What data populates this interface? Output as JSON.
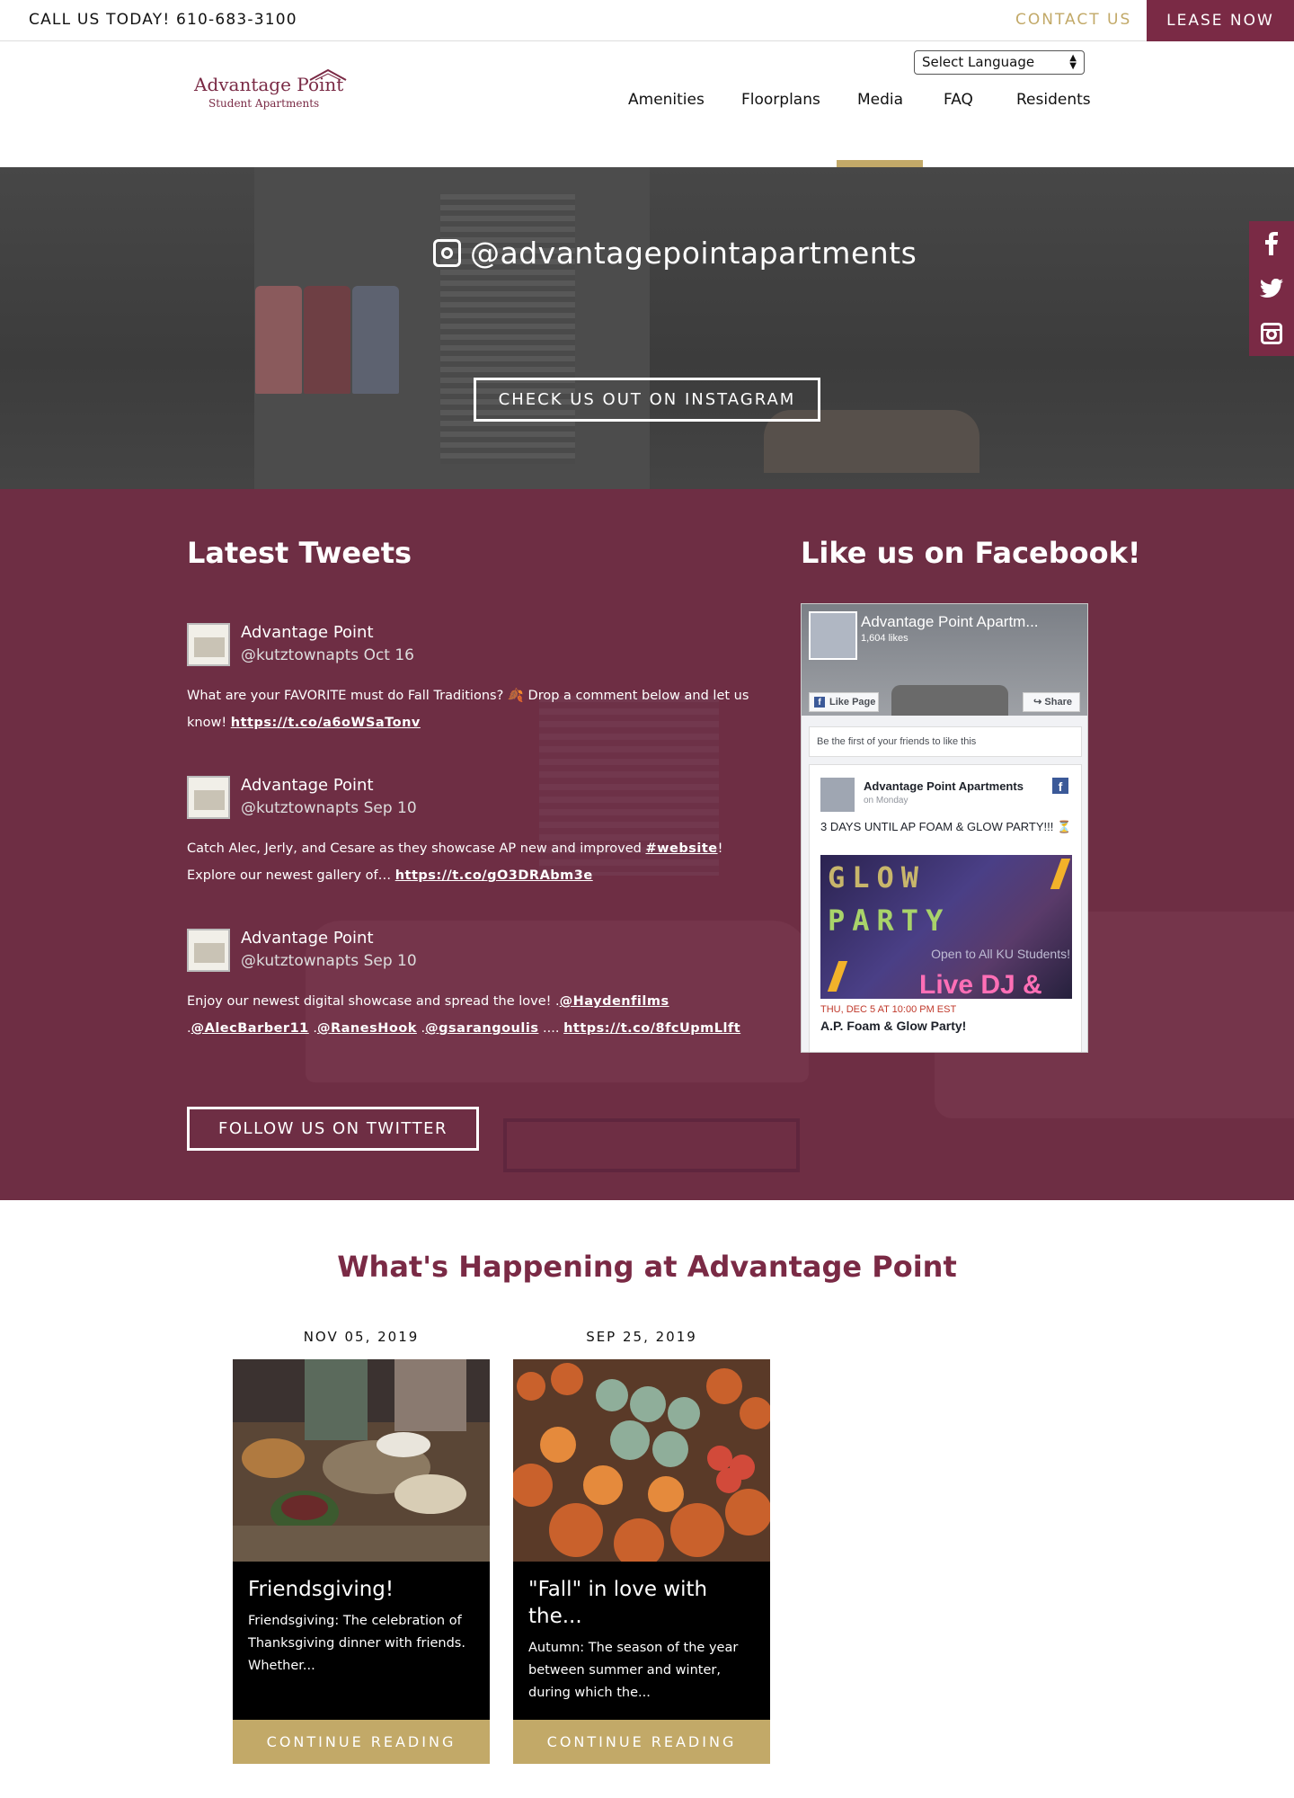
{
  "topbar": {
    "call": "CALL US TODAY! 610-683-3100",
    "contact": "CONTACT US",
    "lease": "LEASE NOW"
  },
  "header": {
    "language_select": "Select Language",
    "logo_main": "Advantage Point",
    "logo_sub": "Student Apartments",
    "nav": [
      {
        "label": "Amenities"
      },
      {
        "label": "Floorplans"
      },
      {
        "label": "Media"
      },
      {
        "label": "FAQ"
      },
      {
        "label": "Residents"
      }
    ],
    "active_nav": "Media"
  },
  "instagram": {
    "handle": "@advantagepointapartments",
    "button": "CHECK US OUT ON INSTAGRAM"
  },
  "social": {
    "facebook": "f",
    "twitter": "🐦",
    "instagram": "ig"
  },
  "tweets": {
    "heading": "Latest Tweets",
    "items": [
      {
        "name": "Advantage Point",
        "handle": "@kutztownapts Oct 16",
        "text": "What are your FAVORITE must do Fall Traditions? 🍂 Drop a comment below and let us know! ",
        "link": "https://t.co/a6oWSaTonv"
      },
      {
        "name": "Advantage Point",
        "handle": "@kutztownapts Sep 10",
        "text_before": "Catch Alec, Jerly, and Cesare as they showcase AP new and improved ",
        "hashtag": "#website",
        "text_after": "! Explore our newest gallery of… ",
        "link": "https://t.co/gO3DRAbm3e"
      },
      {
        "name": "Advantage Point",
        "handle": "@kutztownapts Sep 10",
        "text": "Enjoy our newest digital showcase and spread the love! .",
        "mention1": "@Haydenfilms",
        "sep1": " .",
        "mention2": "@AlecBarber11",
        "sep2": " .",
        "mention3": "@RanesHook",
        "sep3": " .",
        "mention4": "@gsarangoulis",
        "sep4": " .... ",
        "link": "https://t.co/8fcUpmLlft"
      }
    ],
    "follow_button": "FOLLOW US ON TWITTER"
  },
  "facebook": {
    "heading": "Like us on Facebook!",
    "page_name": "Advantage Point Apartm...",
    "likes": "1,604 likes",
    "like_button": "Like Page",
    "share_button": "Share",
    "first_friends": "Be the first of your friends to like this",
    "post_author": "Advantage Point Apartments",
    "post_when": "on Monday",
    "post_text": "3 DAYS UNTIL AP FOAM & GLOW PARTY!!! ⏳",
    "post_image_line1": "GLOW",
    "post_image_line2": "PARTY",
    "post_image_open": "Open to All KU Students!",
    "post_image_live": "Live DJ &",
    "event_date": "THU, DEC 5 AT 10:00 PM EST",
    "event_title": "A.P. Foam & Glow Party!"
  },
  "happening": {
    "title": "What's Happening at Advantage Point",
    "posts": [
      {
        "date": "NOV 05, 2019",
        "title": "Friendsgiving!",
        "excerpt": "Friendsgiving: The celebration of Thanksgiving dinner with friends. Whether...",
        "more": "CONTINUE READING"
      },
      {
        "date": "SEP 25, 2019",
        "title": "\"Fall\" in love with the...",
        "excerpt": "Autumn: The season of the year between summer and winter, during which the...",
        "more": "CONTINUE READING"
      }
    ]
  },
  "colors": {
    "maroon": "#7a2a45",
    "gold": "#c2a968"
  }
}
